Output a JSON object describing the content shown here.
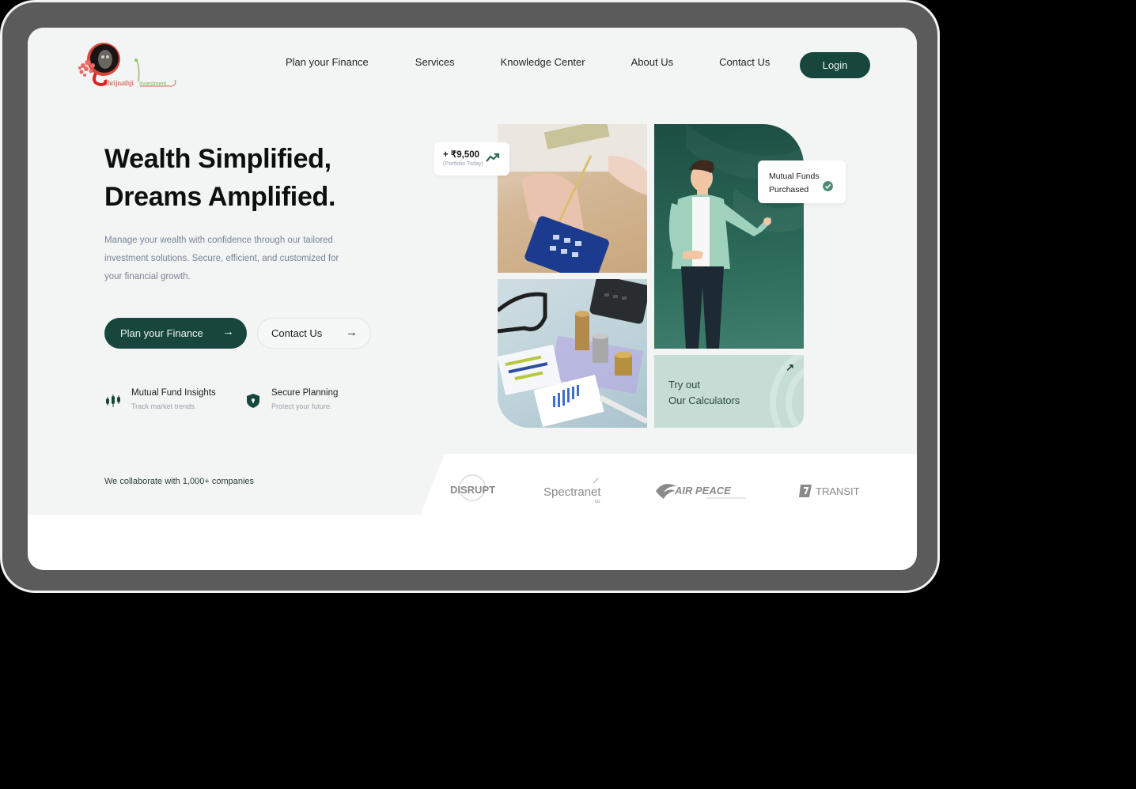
{
  "brand": {
    "logo_text_primary": "Shrijnathji",
    "logo_text_secondary": "Investment",
    "colors": {
      "primary": "#16463c",
      "accent_light": "#c5ddd5",
      "bg": "#f2f5f3"
    }
  },
  "nav": {
    "items": [
      {
        "label": "Plan your Finance"
      },
      {
        "label": "Services"
      },
      {
        "label": "Knowledge Center"
      },
      {
        "label": "About Us"
      },
      {
        "label": "Contact Us"
      }
    ],
    "login_label": "Login"
  },
  "hero": {
    "headline_line1": "Wealth Simplified,",
    "headline_line2": "Dreams Amplified.",
    "subtext": "Manage your wealth with confidence through our tailored investment solutions. Secure, efficient, and customized for your financial growth.",
    "primary_button": "Plan your Finance",
    "secondary_button": "Contact Us",
    "arrow_glyph": "→",
    "features": [
      {
        "title": "Mutual Fund Insights",
        "subtitle": "Track market trends.",
        "icon": "candlestick-chart-icon"
      },
      {
        "title": "Secure Planning",
        "subtitle": "Protect your future.",
        "icon": "shield-lock-icon"
      }
    ]
  },
  "collage": {
    "portfolio_badge": {
      "amount": "+ ₹9,500",
      "label": "(Portfolio Today)",
      "icon": "trending-up-icon"
    },
    "mutual_funds_badge": {
      "line1": "Mutual Funds",
      "line2": "Purchased",
      "icon": "check-circle-icon"
    },
    "calculator_card": {
      "line1": "Try out",
      "line2": "Our Calculators",
      "arrow_glyph": "↗"
    },
    "images": [
      {
        "alt": "Hands with pencil and calculator holding cash"
      },
      {
        "alt": "Glasses, coins, calculator and financial charts"
      },
      {
        "alt": "Illustrated man in green blazer pointing"
      }
    ]
  },
  "partners": {
    "heading": "We collaborate with 1,000+ companies",
    "logos": [
      {
        "name": "DISRUPT"
      },
      {
        "name": "Spectranet",
        "sub": "5G"
      },
      {
        "name": "AIR PEACE"
      },
      {
        "name": "TRANSIT"
      }
    ]
  }
}
